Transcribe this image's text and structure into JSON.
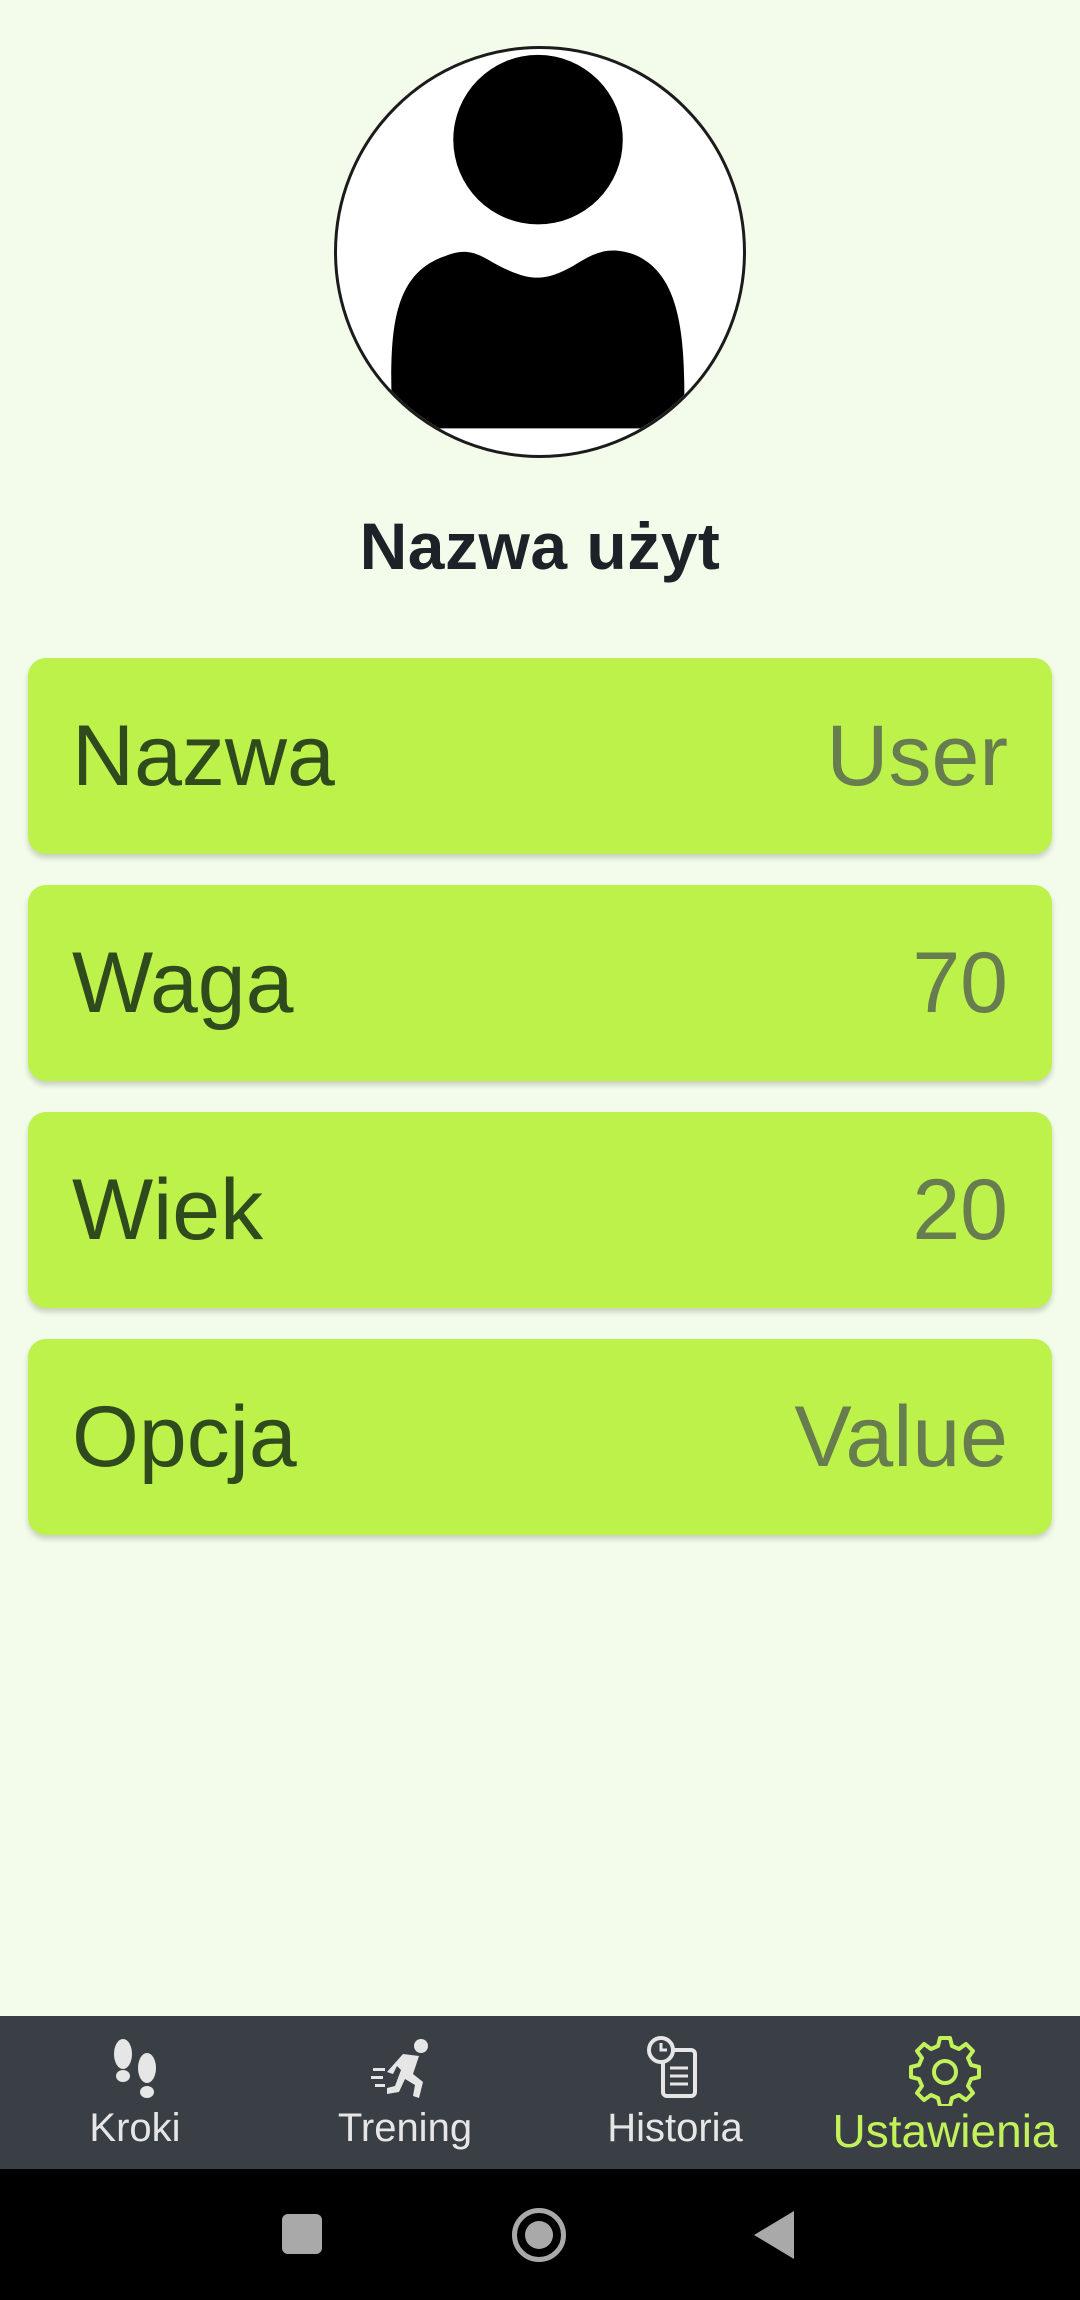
{
  "profile": {
    "avatar_icon": "user-silhouette-icon",
    "title": "Nazwa użyt"
  },
  "settings": [
    {
      "label": "Nazwa",
      "value": "User"
    },
    {
      "label": "Waga",
      "value": "70"
    },
    {
      "label": "Wiek",
      "value": "20"
    },
    {
      "label": "Opcja",
      "value": "Value"
    }
  ],
  "bottom_nav": {
    "items": [
      {
        "label": "Kroki",
        "icon": "footprints-icon",
        "active": false
      },
      {
        "label": "Trening",
        "icon": "runner-icon",
        "active": false
      },
      {
        "label": "Historia",
        "icon": "history-clipboard-icon",
        "active": false
      },
      {
        "label": "Ustawienia",
        "icon": "gear-icon",
        "active": true
      }
    ]
  },
  "system_nav": {
    "buttons": [
      "recent-apps-icon",
      "home-icon",
      "back-icon"
    ]
  },
  "colors": {
    "background": "#f3fcea",
    "card": "#bcf24a",
    "label_text": "#2f4a1c",
    "value_text": "#677d4f",
    "nav_background": "#3a3f46",
    "nav_active": "#c3f15a",
    "nav_inactive": "#e6e6e6"
  }
}
